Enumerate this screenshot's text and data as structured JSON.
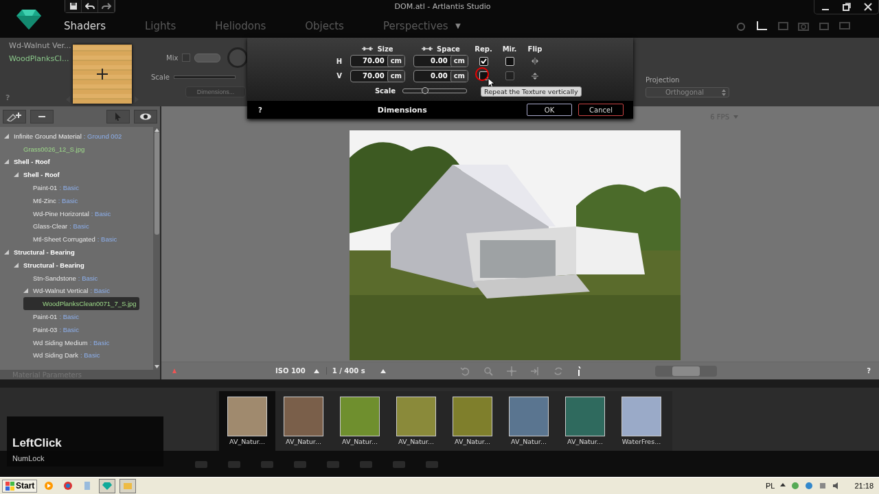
{
  "window": {
    "title": "DOM.atl - Artlantis Studio"
  },
  "tabs": [
    {
      "label": "Shaders",
      "selected": true
    },
    {
      "label": "Lights",
      "selected": false
    },
    {
      "label": "Heliodons",
      "selected": false
    },
    {
      "label": "Objects",
      "selected": false
    },
    {
      "label": "Perspectives",
      "selected": false
    }
  ],
  "tabs_menu": "▼",
  "shader": {
    "name": "Wd-Walnut Ver...",
    "texture": "WoodPlanksCl...",
    "help": "?",
    "mix_label": "Mix",
    "mix_checked": false,
    "scale": {
      "label": "Scale",
      "level": 0
    },
    "dimensions_button": "Dimensions...",
    "projection_label": "Projection",
    "projection_value": "Orthogonal"
  },
  "dialog": {
    "size_label": "Size",
    "space_label": "Space",
    "repeat_label": "Rep.",
    "mirror_label": "Mir.",
    "flip_label": "Flip",
    "rows": [
      {
        "axis": "H",
        "size": "70.00",
        "size_unit": "cm",
        "space": "0.00",
        "space_unit": "cm",
        "repeat": true,
        "mirror": false,
        "mirror_disabled": false
      },
      {
        "axis": "V",
        "size": "70.00",
        "size_unit": "cm",
        "space": "0.00",
        "space_unit": "cm",
        "repeat": false,
        "mirror": false,
        "mirror_disabled": true
      }
    ],
    "scale": {
      "label": "Scale",
      "level": 0.35
    },
    "help": "?",
    "title": "Dimensions",
    "ok": "OK",
    "cancel": "Cancel",
    "tooltip": "Repeat the Texture vertically"
  },
  "tree": [
    {
      "kind": "ground",
      "label": "Infinite Ground Material",
      "material": ": Ground 002",
      "expanded": true,
      "selected": false,
      "children": [
        {
          "kind": "texture",
          "label": "Grass0026_12_S.jpg",
          "selected": false
        }
      ]
    },
    {
      "kind": "group",
      "label": "Shell - Roof",
      "expanded": true,
      "selected": false,
      "children": [
        {
          "kind": "group",
          "label": "Shell - Roof",
          "expanded": true,
          "selected": false,
          "children": [
            {
              "kind": "material",
              "label": "Paint-01",
              "material": ": Basic",
              "selected": false
            },
            {
              "kind": "material",
              "label": "Mtl-Zinc",
              "material": ": Basic",
              "selected": false
            },
            {
              "kind": "material",
              "label": "Wd-Pine Horizontal",
              "material": ": Basic",
              "selected": false
            },
            {
              "kind": "material",
              "label": "Glass-Clear",
              "material": ": Basic",
              "selected": false
            },
            {
              "kind": "material",
              "label": "Mtl-Sheet Corrugated",
              "material": ": Basic",
              "selected": false
            }
          ]
        }
      ]
    },
    {
      "kind": "group",
      "label": "Structural - Bearing",
      "expanded": true,
      "selected": false,
      "children": [
        {
          "kind": "group",
          "label": "Structural - Bearing",
          "expanded": true,
          "selected": false,
          "children": [
            {
              "kind": "material",
              "label": "Stn-Sandstone",
              "material": ": Basic",
              "selected": false
            },
            {
              "kind": "material",
              "label": "Wd-Walnut Vertical",
              "material": ": Basic",
              "expanded": true,
              "selected": false,
              "children": [
                {
                  "kind": "texture",
                  "label": "WoodPlanksClean0071_7_S.jpg",
                  "selected": true
                }
              ]
            },
            {
              "kind": "material",
              "label": "Paint-01",
              "material": ": Basic",
              "selected": false
            },
            {
              "kind": "material",
              "label": "Paint-03",
              "material": ": Basic",
              "selected": false
            },
            {
              "kind": "material",
              "label": "Wd Siding Medium",
              "material": ": Basic",
              "selected": false
            },
            {
              "kind": "material",
              "label": "Wd Siding Dark",
              "material": ": Basic",
              "selected": false
            }
          ]
        }
      ]
    }
  ],
  "tree_footer": "Material Parameters",
  "viewport": {
    "fps": "6 FPS",
    "iso": "ISO 100",
    "shutter": "1 / 400 s",
    "zoom": {
      "level": 0.5
    },
    "help": "?"
  },
  "catalog": [
    {
      "label": "AV_Natur...",
      "color": "#a08a6e",
      "selected": true
    },
    {
      "label": "AV_Natur...",
      "color": "#7a5f4a",
      "selected": false
    },
    {
      "label": "AV_Natur...",
      "color": "#6f8f2e",
      "selected": false
    },
    {
      "label": "AV_Natur...",
      "color": "#8a8a3a",
      "selected": false
    },
    {
      "label": "AV_Natur...",
      "color": "#7f7f2c",
      "selected": false
    },
    {
      "label": "AV_Natur...",
      "color": "#5a7590",
      "selected": false
    },
    {
      "label": "AV_Natur...",
      "color": "#2f6a5e",
      "selected": false
    },
    {
      "label": "WaterFres...",
      "color": "#9aaac8",
      "selected": false
    }
  ],
  "key_overlay": {
    "key": "LeftClick",
    "modifier": "NumLock"
  },
  "taskbar": {
    "start": "Start",
    "language": "PL",
    "time": "21:18"
  }
}
